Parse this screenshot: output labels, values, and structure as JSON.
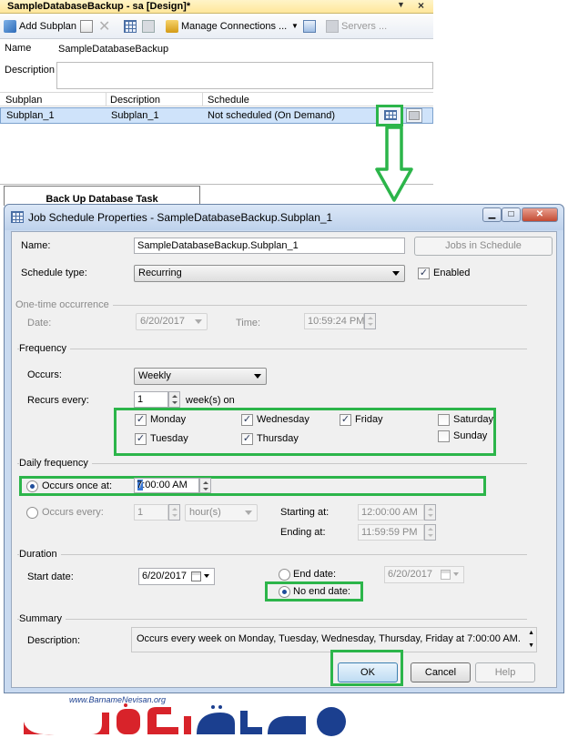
{
  "designer": {
    "tab_title": "SampleDatabaseBackup - sa [Design]*",
    "toolbar": {
      "add_subplan": "Add Subplan",
      "manage_connections": "Manage Connections ...",
      "servers": "Servers ..."
    },
    "name_label": "Name",
    "name_value": "SampleDatabaseBackup",
    "description_label": "Description",
    "grid": {
      "columns": [
        "Subplan",
        "Description",
        "Schedule"
      ],
      "row": {
        "subplan": "Subplan_1",
        "description": "Subplan_1",
        "schedule": "Not scheduled (On Demand)"
      }
    },
    "task_box_label": "Back Up Database Task"
  },
  "dialog": {
    "title": "Job Schedule Properties - SampleDatabaseBackup.Subplan_1",
    "name_label": "Name:",
    "name_value": "SampleDatabaseBackup.Subplan_1",
    "jobs_in_schedule": "Jobs in Schedule",
    "schedule_type_label": "Schedule type:",
    "schedule_type_value": "Recurring",
    "enabled_label": "Enabled",
    "onetime": {
      "section": "One-time occurrence",
      "date_label": "Date:",
      "date_value": "6/20/2017",
      "time_label": "Time:",
      "time_value": "10:59:24 PM"
    },
    "frequency": {
      "section": "Frequency",
      "occurs_label": "Occurs:",
      "occurs_value": "Weekly",
      "recurs_label": "Recurs every:",
      "recurs_value": "1",
      "recurs_unit": "week(s) on",
      "days": {
        "monday": "Monday",
        "tuesday": "Tuesday",
        "wednesday": "Wednesday",
        "thursday": "Thursday",
        "friday": "Friday",
        "saturday": "Saturday",
        "sunday": "Sunday"
      }
    },
    "daily": {
      "section": "Daily frequency",
      "once_label": "Occurs once at:",
      "once_value": "7:00:00 AM",
      "every_label": "Occurs every:",
      "every_value": "1",
      "every_unit": "hour(s)",
      "starting_label": "Starting at:",
      "starting_value": "12:00:00 AM",
      "ending_label": "Ending at:",
      "ending_value": "11:59:59 PM"
    },
    "duration": {
      "section": "Duration",
      "start_label": "Start date:",
      "start_value": "6/20/2017",
      "end_label": "End date:",
      "end_value": "6/20/2017",
      "noend_label": "No end date:"
    },
    "summary": {
      "section": "Summary",
      "desc_label": "Description:",
      "desc_value": "Occurs every week on Monday, Tuesday, Wednesday, Thursday, Friday at 7:00:00 AM."
    },
    "buttons": {
      "ok": "OK",
      "cancel": "Cancel",
      "help": "Help"
    }
  },
  "logo": {
    "url_text": "www.BarnameNevisan.org"
  },
  "colors": {
    "highlight": "#2cb54a",
    "selection": "#cfe3fa",
    "logo_red": "#d8232a",
    "logo_blue": "#1b3f8f"
  }
}
